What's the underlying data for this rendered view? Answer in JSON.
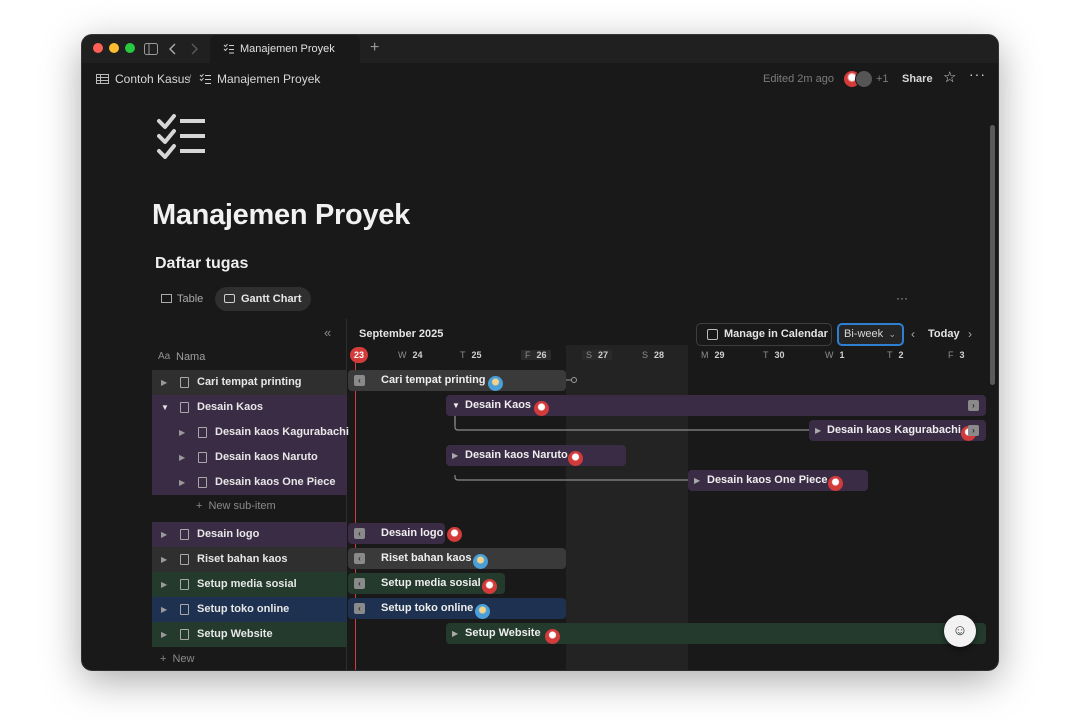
{
  "tab": {
    "title": "Manajemen Proyek"
  },
  "breadcrumb": {
    "workspace": "Contoh Kasus",
    "separator": "/",
    "page": "Manajemen Proyek"
  },
  "header": {
    "edited": "Edited 2m ago",
    "plus_count": "+1",
    "share": "Share"
  },
  "page": {
    "title": "Manajemen Proyek",
    "section": "Daftar tugas"
  },
  "views": {
    "table": "Table",
    "gantt": "Gantt Chart"
  },
  "timeline": {
    "month": "September 2025",
    "manage_calendar": "Manage in Calendar",
    "range": "Bi-week",
    "today": "Today",
    "today_badge": "23",
    "days": [
      {
        "dow": "W",
        "num": "24"
      },
      {
        "dow": "T",
        "num": "25"
      },
      {
        "dow": "F",
        "num": "26"
      },
      {
        "dow": "S",
        "num": "27"
      },
      {
        "dow": "S",
        "num": "28"
      },
      {
        "dow": "M",
        "num": "29"
      },
      {
        "dow": "T",
        "num": "30"
      },
      {
        "dow": "W",
        "num": "1"
      },
      {
        "dow": "T",
        "num": "2"
      },
      {
        "dow": "F",
        "num": "3"
      }
    ]
  },
  "list": {
    "column": "Nama",
    "column_prefix": "Aa",
    "new_sub_item": "New sub-item",
    "new": "New"
  },
  "tasks": [
    {
      "name": "Cari tempat printing",
      "avatar": "blue"
    },
    {
      "name": "Desain Kaos",
      "avatar": "red"
    },
    {
      "name": "Desain kaos Kagurabachi",
      "avatar": "red"
    },
    {
      "name": "Desain kaos Naruto",
      "avatar": "red"
    },
    {
      "name": "Desain kaos One Piece",
      "avatar": "red"
    },
    {
      "name": "Desain logo",
      "avatar": "red"
    },
    {
      "name": "Riset bahan kaos",
      "avatar": "blue"
    },
    {
      "name": "Setup media sosial",
      "avatar": "red"
    },
    {
      "name": "Setup toko online",
      "avatar": "blue"
    },
    {
      "name": "Setup Website",
      "avatar": "red"
    }
  ],
  "colors": {
    "purple": "#3b2c45",
    "green": "#233a2c",
    "blue": "#1f3150",
    "gray": "#2f2f2f",
    "today_red": "#d43c3c",
    "accent_blue": "#2f7fd1"
  }
}
